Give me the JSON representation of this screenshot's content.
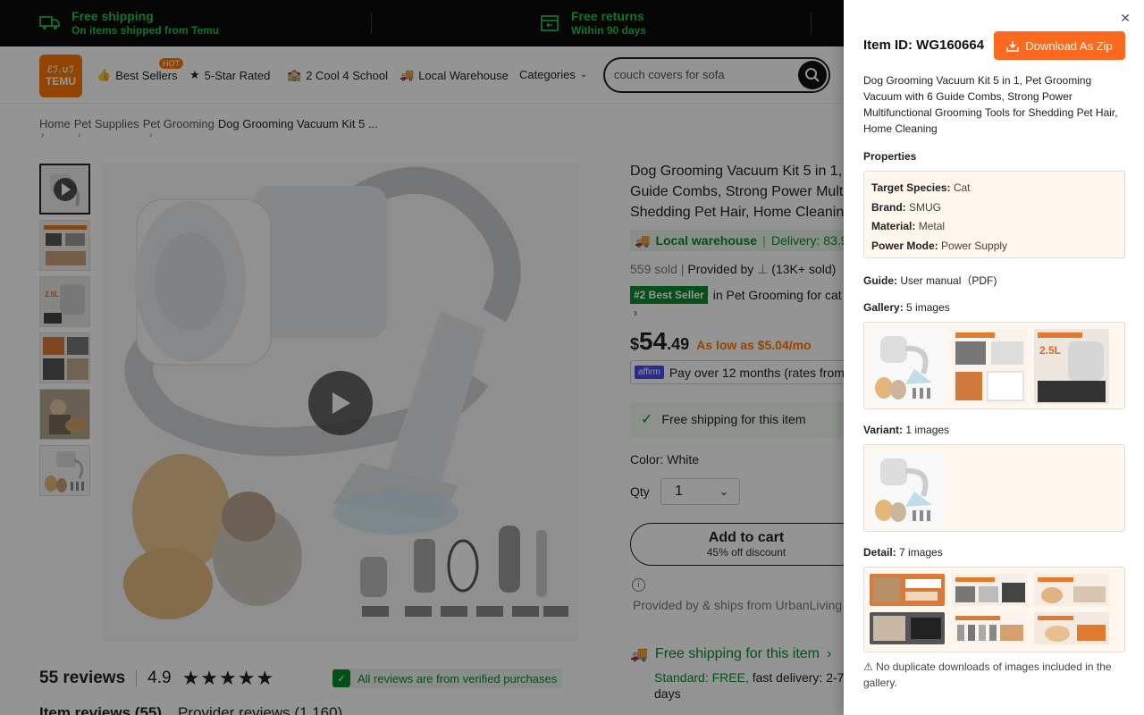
{
  "promo": {
    "shipping_title": "Free shipping",
    "shipping_sub": "On items shipped from Temu",
    "returns_title": "Free returns",
    "returns_sub": "Within 90 days"
  },
  "header": {
    "logo_glyphs": "ℰℐ.∪ℐ",
    "logo_text": "TEMU",
    "hot_badge": "HOT",
    "nav": [
      "Best Sellers",
      "5-Star Rated",
      "2 Cool 4 School",
      "Local Warehouse",
      "Categories"
    ],
    "search_value": "couch covers for sofa"
  },
  "breadcrumb": [
    "Home",
    "Pet Supplies",
    "Pet Grooming",
    "Dog Grooming Vacuum Kit 5 ..."
  ],
  "product": {
    "title_line1": "Dog Grooming Vacuum Kit 5 in 1,",
    "title_line2": "Guide Combs, Strong Power Mult",
    "title_line3": "Shedding Pet Hair, Home Cleanin",
    "local_warehouse": "Local warehouse",
    "delivery": "Delivery: 83.9",
    "sold": "559 sold",
    "provided_by": "Provided by",
    "sold_count": "(13K+ sold)",
    "best_tag": "#2 Best Seller",
    "best_in": "in Pet Grooming for cat",
    "price_dollar": "$",
    "price_main": "54",
    "price_cents": ".49",
    "as_low": "As low as $5.04/mo",
    "affirm_logo": "affirm",
    "affirm_text": "Pay over 12 months (rates from",
    "free_ship_box": "Free shipping for this item",
    "color_label": "Color: White",
    "qty_label": "Qty",
    "qty_value": "1",
    "add_cart": "Add to cart",
    "discount": "45% off discount",
    "provided_ships": "Provided by & ships from UrbanLiving",
    "free_ship2": "Free shipping for this item",
    "standard": "Standard: FREE,",
    "fast": "fast delivery: 2-7",
    "days": "days"
  },
  "reviews": {
    "count": "55 reviews",
    "rating": "4.9",
    "stars": "★★★★★",
    "verified": "All reviews are from verified purchases",
    "tab_items": "Item reviews (55)",
    "tab_provider": "Provider reviews (1,160)"
  },
  "panel": {
    "item_id": "Item ID: WG160664",
    "download": "Download As Zip",
    "description": "Dog Grooming Vacuum Kit 5 in 1, Pet Grooming Vacuum with 6 Guide Combs, Strong Power Multifunctional Grooming Tools for Shedding Pet Hair, Home Cleaning",
    "properties_label": "Properties",
    "properties": [
      {
        "k": "Target Species:",
        "v": "Cat"
      },
      {
        "k": "Brand:",
        "v": "SMUG"
      },
      {
        "k": "Material:",
        "v": "Metal"
      },
      {
        "k": "Power Mode:",
        "v": "Power Supply"
      }
    ],
    "guide_label": "Guide:",
    "guide_value": "User manual（PDF)",
    "gallery_label": "Gallery:",
    "gallery_count": "5 images",
    "variant_label": "Variant:",
    "variant_count": "1 images",
    "detail_label": "Detail:",
    "detail_count": "7 images",
    "warning": "⚠ No duplicate downloads of images included in the gallery."
  }
}
